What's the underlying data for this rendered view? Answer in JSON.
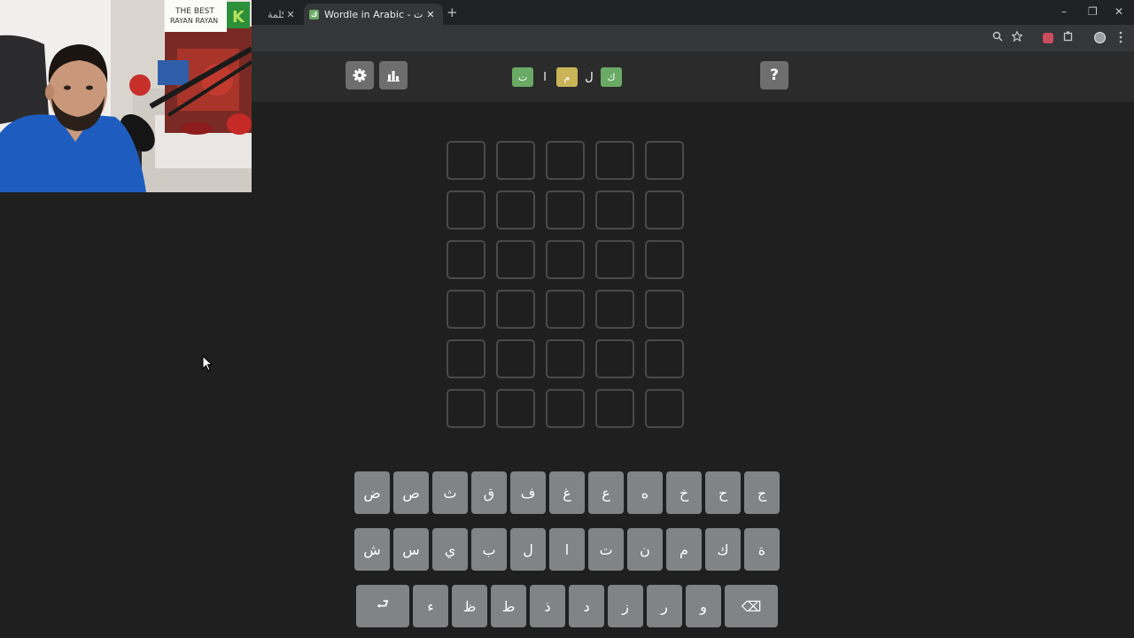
{
  "browser": {
    "tabs": [
      {
        "title": "كلمة"
      },
      {
        "title": "Wordle in Arabic - كلمات",
        "favicon": "ك"
      }
    ],
    "close_glyph": "✕",
    "new_tab_glyph": "+",
    "window": {
      "minimize": "–",
      "restore": "❐",
      "close": "✕"
    }
  },
  "header": {
    "logo": [
      {
        "letter": "ك",
        "state": "correct"
      },
      {
        "letter": "ل",
        "state": "plain"
      },
      {
        "letter": "م",
        "state": "present"
      },
      {
        "letter": "ا",
        "state": "plain"
      },
      {
        "letter": "ت",
        "state": "correct"
      }
    ],
    "help_label": "?",
    "icons": {
      "settings": "gear-icon",
      "stats": "bar-chart-icon"
    }
  },
  "colors": {
    "correct": "#6aaa64",
    "present": "#c9b458",
    "key": "#818384",
    "empty_border": "#4a4a4c"
  },
  "board": {
    "rows": 6,
    "cols": 5
  },
  "keyboard": {
    "row1": [
      "ج",
      "ح",
      "خ",
      "ه",
      "ع",
      "غ",
      "ف",
      "ق",
      "ث",
      "ص",
      "ض"
    ],
    "row2": [
      "ة",
      "ك",
      "م",
      "ن",
      "ت",
      "ا",
      "ل",
      "ب",
      "ي",
      "س",
      "ش"
    ],
    "row3": [
      "و",
      "ر",
      "ز",
      "د",
      "ذ",
      "ط",
      "ظ",
      "ء"
    ],
    "enter_label": "⮐",
    "backspace_label": "⌫"
  },
  "webcam": {
    "sign_line1": "THE BEST",
    "sign_line2": "RAYAN RAYAN",
    "badge_letter": "K"
  }
}
